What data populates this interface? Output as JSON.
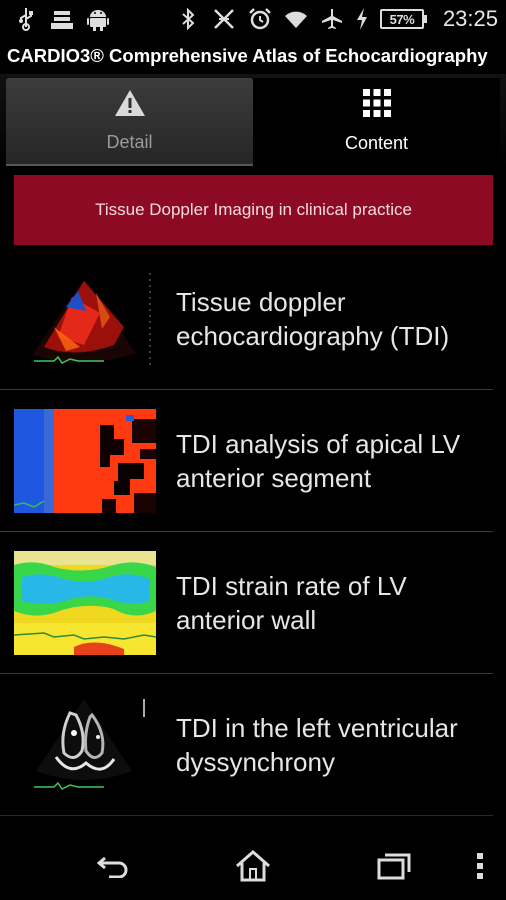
{
  "status_bar": {
    "battery_percent": "57%",
    "time": "23:25",
    "left_icons": [
      "usb-icon",
      "file-download-icon",
      "android-icon"
    ],
    "right_icons": [
      "bluetooth-icon",
      "nfc-icon",
      "alarm-icon",
      "wifi-icon",
      "airplane-mode-icon",
      "charging-icon"
    ]
  },
  "app": {
    "title": "CARDIO3® Comprehensive Atlas of Echocardiography"
  },
  "tabs": [
    {
      "label": "Detail",
      "icon": "warning-icon",
      "active": false
    },
    {
      "label": "Content",
      "icon": "grid-icon",
      "active": true
    }
  ],
  "section": {
    "title": "Tissue Doppler Imaging in clinical practice",
    "color": "#8c0a24"
  },
  "items": [
    {
      "title": "Tissue doppler echocardiography (TDI)"
    },
    {
      "title": "TDI analysis of apical LV anterior segment"
    },
    {
      "title": "TDI strain rate of LV anterior wall"
    },
    {
      "title": "TDI in the left ventricular dyssynchrony"
    }
  ],
  "nav": {
    "icons": [
      "back-icon",
      "home-icon",
      "recent-apps-icon",
      "overflow-menu-icon"
    ]
  }
}
